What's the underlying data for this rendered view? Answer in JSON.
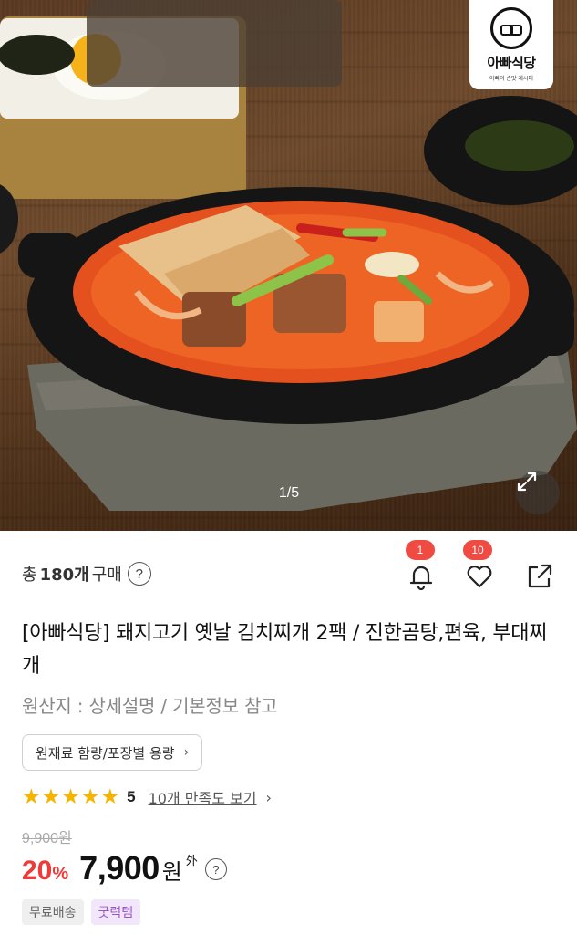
{
  "hero": {
    "logo_text": "아빠식당",
    "logo_subtext": "아빠의 손맛 레시피",
    "pager_text": "1/5"
  },
  "icons": {
    "expand": "expand-diagonal-icon",
    "help": "question-circle-icon",
    "bell": "bell-icon",
    "heart": "heart-icon",
    "share": "share-icon",
    "star": "star-icon",
    "chevron": "chevron-right-icon"
  },
  "purchase": {
    "prefix": "총",
    "count": "180개",
    "suffix": "구매",
    "help_glyph": "?"
  },
  "actions": {
    "notify_badge": "1",
    "like_badge": "10"
  },
  "product": {
    "title": "[아빠식당] 돼지고기 옛날 김치찌개 2팩 / 진한곰탕,편육, 부대찌개",
    "origin": "원산지 : 상세설명 / 기본정보 참고",
    "ingredient_button": "원재료 함량/포장별 용량"
  },
  "rating": {
    "stars": 5,
    "score": "5",
    "review_link": "10개 만족도 보기"
  },
  "price": {
    "original": "9,900원",
    "discount": "20",
    "discount_unit": "%",
    "sale": "7,900",
    "unit": "원",
    "extra": "外",
    "help_glyph": "?"
  },
  "tags": [
    "무료배송",
    "굿럭템"
  ],
  "colors": {
    "accent_red": "#f03a3a",
    "badge_red": "#ef4b43",
    "star_yellow": "#f5b400",
    "tag_purple": "#9a55c8"
  }
}
